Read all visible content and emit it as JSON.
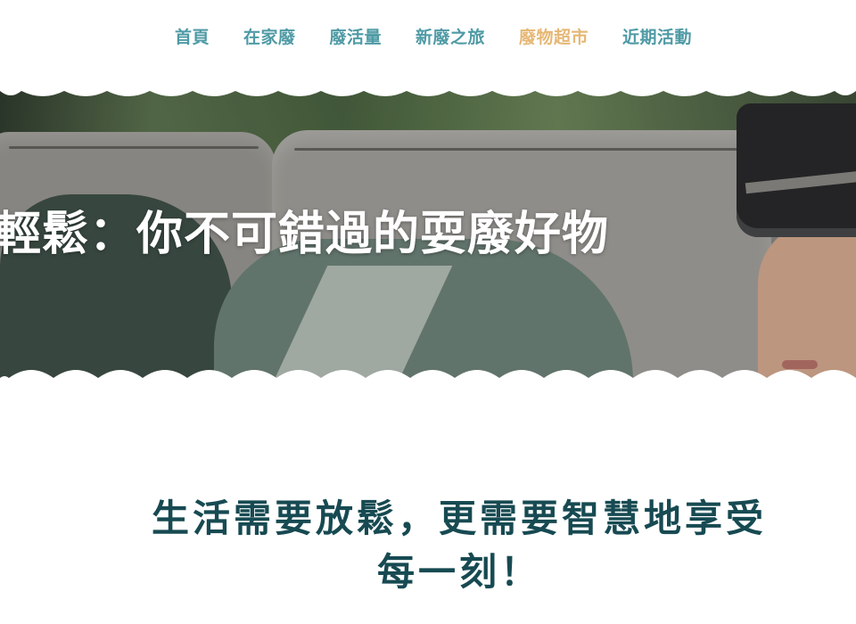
{
  "nav": {
    "items": [
      {
        "label": "首頁"
      },
      {
        "label": "在家廢"
      },
      {
        "label": "廢活量"
      },
      {
        "label": "新廢之旅"
      },
      {
        "label": "廢物超市"
      },
      {
        "label": "近期活動"
      }
    ],
    "active_index": 4,
    "color": "#4e9aa5",
    "active_color": "#e6b774"
  },
  "hero": {
    "title": "輕鬆：你不可錯過的耍廢好物"
  },
  "section": {
    "heading_line1": "生活需要放鬆，更需要智慧地享受",
    "heading_line2": "每一刻！",
    "heading_color": "#174a52"
  }
}
